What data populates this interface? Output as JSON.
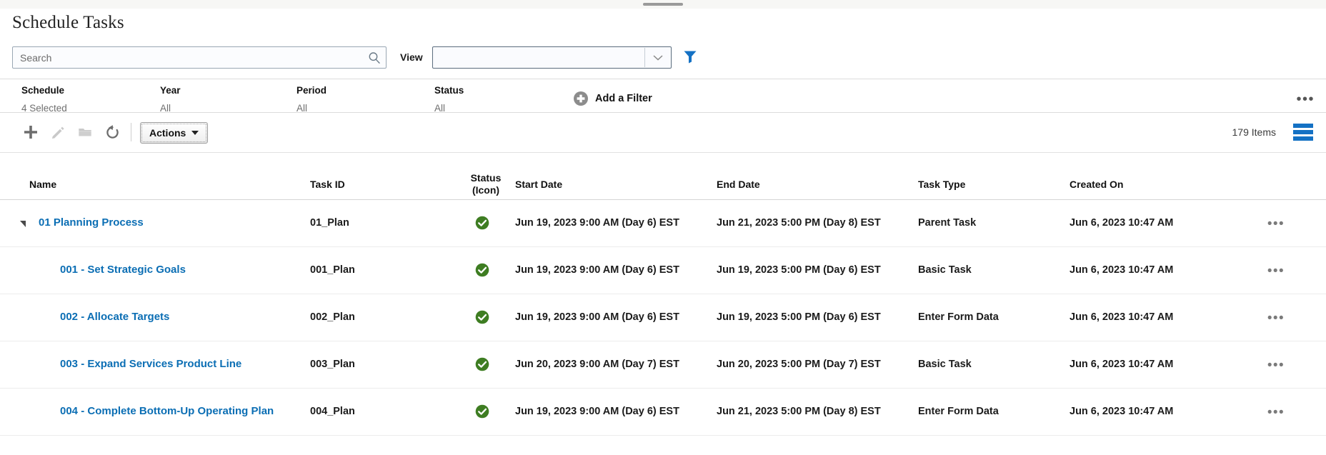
{
  "window": {
    "drag_handle": "window-drag-handle"
  },
  "header": {
    "title": "Schedule Tasks"
  },
  "search": {
    "placeholder": "Search",
    "value": "",
    "icon": "search-icon"
  },
  "view": {
    "label": "View",
    "selected": "",
    "chevron_icon": "chevron-down-icon",
    "filter_icon": "funnel-filter-icon",
    "filter_color": "#1471c4"
  },
  "filter_bar": {
    "filters": [
      {
        "name": "Schedule",
        "value": "4 Selected"
      },
      {
        "name": "Year",
        "value": "All"
      },
      {
        "name": "Period",
        "value": "All"
      },
      {
        "name": "Status",
        "value": "All"
      }
    ],
    "add_filter": {
      "label": "Add a Filter",
      "icon": "plus-circle-icon"
    },
    "overflow": "•••"
  },
  "toolbar": {
    "icons": [
      {
        "name": "add-icon",
        "glyph": "+",
        "enabled": true
      },
      {
        "name": "edit-pencil-icon",
        "glyph": "✎",
        "enabled": false
      },
      {
        "name": "folder-icon",
        "glyph": "▬",
        "enabled": false
      },
      {
        "name": "refresh-icon",
        "glyph": "↺",
        "enabled": true
      }
    ],
    "actions_label": "Actions",
    "items_count": "179 Items",
    "layout_icon": "list-layout-icon",
    "layout_color": "#1471c4"
  },
  "table": {
    "columns": [
      {
        "key": "name",
        "label": "Name"
      },
      {
        "key": "task_id",
        "label": "Task ID"
      },
      {
        "key": "status",
        "label": "Status",
        "label2": "(Icon)"
      },
      {
        "key": "start_date",
        "label": "Start Date"
      },
      {
        "key": "end_date",
        "label": "End Date"
      },
      {
        "key": "task_type",
        "label": "Task Type"
      },
      {
        "key": "created_on",
        "label": "Created On"
      }
    ],
    "rows": [
      {
        "name": "01 Planning Process",
        "task_id": "01_Plan",
        "status": "complete",
        "start_date": "Jun 19, 2023 9:00 AM (Day 6) EST",
        "end_date": "Jun 21, 2023 5:00 PM (Day 8) EST",
        "task_type": "Parent Task",
        "created_on": "Jun 6, 2023 10:47 AM",
        "level": 0,
        "expanded": true
      },
      {
        "name": "001 - Set Strategic Goals",
        "task_id": "001_Plan",
        "status": "complete",
        "start_date": "Jun 19, 2023 9:00 AM (Day 6) EST",
        "end_date": "Jun 19, 2023 5:00 PM (Day 6) EST",
        "task_type": "Basic Task",
        "created_on": "Jun 6, 2023 10:47 AM",
        "level": 1,
        "expanded": false
      },
      {
        "name": "002 - Allocate Targets",
        "task_id": "002_Plan",
        "status": "complete",
        "start_date": "Jun 19, 2023 9:00 AM (Day 6) EST",
        "end_date": "Jun 19, 2023 5:00 PM (Day 6) EST",
        "task_type": "Enter Form Data",
        "created_on": "Jun 6, 2023 10:47 AM",
        "level": 1,
        "expanded": false
      },
      {
        "name": "003 - Expand Services Product Line",
        "task_id": "003_Plan",
        "status": "complete",
        "start_date": "Jun 20, 2023 9:00 AM (Day 7) EST",
        "end_date": "Jun 20, 2023 5:00 PM (Day 7) EST",
        "task_type": "Basic Task",
        "created_on": "Jun 6, 2023 10:47 AM",
        "level": 1,
        "expanded": false
      },
      {
        "name": "004 - Complete Bottom-Up Operating Plan",
        "task_id": "004_Plan",
        "status": "complete",
        "start_date": "Jun 19, 2023 9:00 AM (Day 6) EST",
        "end_date": "Jun 21, 2023 5:00 PM (Day 8) EST",
        "task_type": "Enter Form Data",
        "created_on": "Jun 6, 2023 10:47 AM",
        "level": 1,
        "expanded": false
      }
    ],
    "row_overflow": "•••",
    "status_complete_color": "#3e7d22",
    "link_color": "#0b6eb4"
  }
}
